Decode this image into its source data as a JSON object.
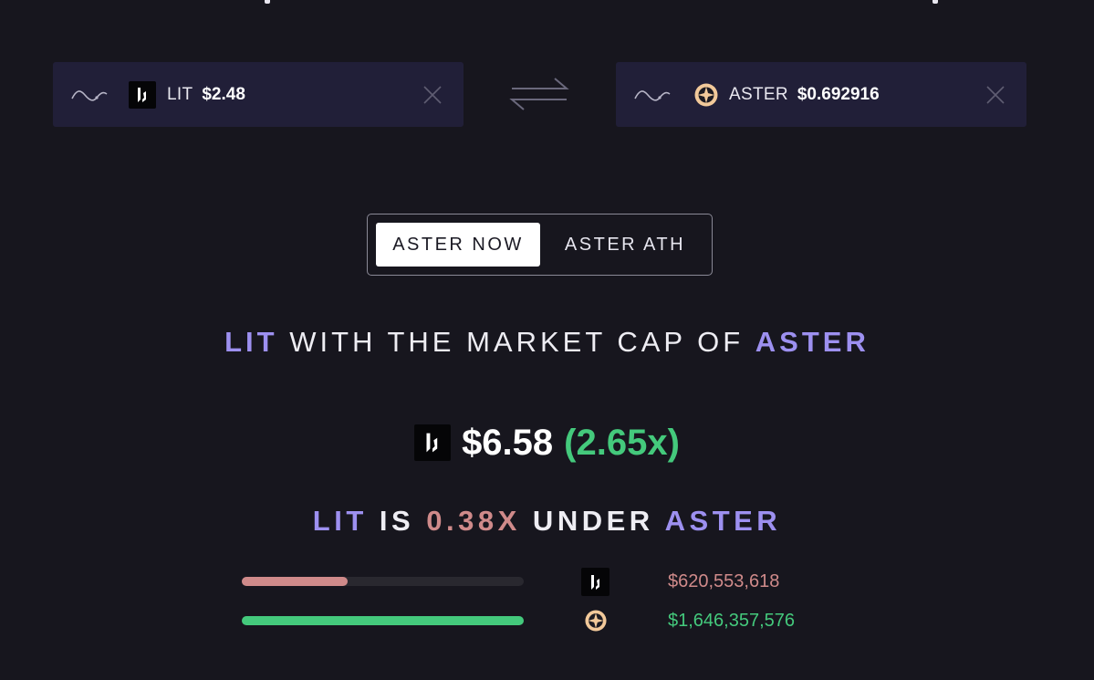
{
  "colors": {
    "background": "#17161e",
    "card": "#211f38",
    "accent_purple": "#9d90f0",
    "accent_green": "#44c97c",
    "accent_pink": "#cf8a8a"
  },
  "left_token": {
    "icon": "lit-logo",
    "symbol": "LIT",
    "price": "$2.48"
  },
  "right_token": {
    "icon": "aster-logo",
    "symbol": "ASTER",
    "price": "$0.692916"
  },
  "toggle": {
    "options": [
      "ASTER NOW",
      "ASTER ATH"
    ],
    "selected": "ASTER NOW"
  },
  "headline": {
    "token_a": "LIT",
    "middle": " WITH THE MARKET CAP OF ",
    "token_b": "ASTER"
  },
  "result": {
    "price": "$6.58",
    "multiplier": "(2.65x)"
  },
  "comparison": {
    "token_a": "LIT",
    "is": " IS ",
    "ratio": "0.38X",
    "under": " UNDER ",
    "token_b": "ASTER"
  },
  "market_caps": [
    {
      "token": "LIT",
      "icon": "lit-logo",
      "value": "$620,553,618",
      "fill_fraction": 0.377,
      "color": "#cf8a8a"
    },
    {
      "token": "ASTER",
      "icon": "aster-logo",
      "value": "$1,646,357,576",
      "fill_fraction": 1.0,
      "color": "#44c97c"
    }
  ]
}
